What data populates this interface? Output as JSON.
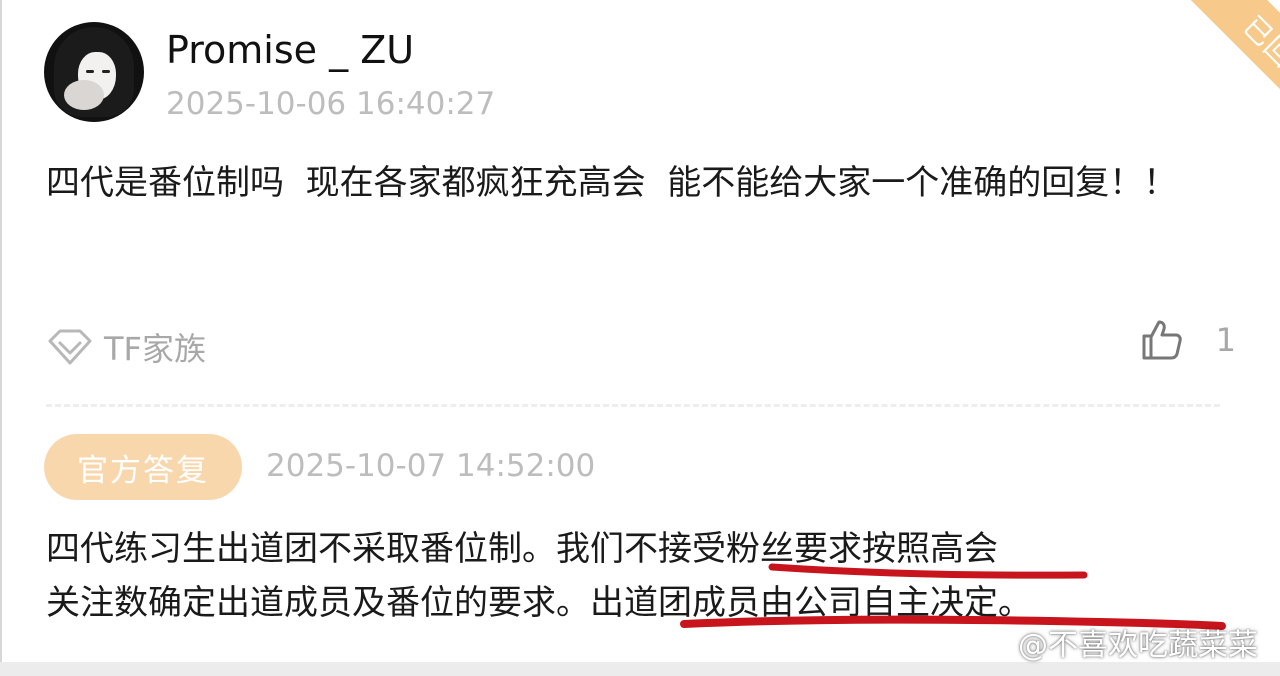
{
  "corner_badge": "已回复",
  "post": {
    "username": "Promise _ ZU",
    "timestamp": "2025-10-06 16:40:27",
    "content": "四代是番位制吗  现在各家都疯狂充高会  能不能给大家一个准确的回复！！",
    "tag": "TF家族",
    "like_count": "1"
  },
  "reply": {
    "badge": "官方答复",
    "timestamp": "2025-10-07 14:52:00",
    "line1": {
      "pre": "四代练习生出道团不采取番位制。我们",
      "highlight": "不接受粉丝要求",
      "post": "按照高会"
    },
    "line2": {
      "pre": "关注数确定出道成员及番位的要求。",
      "highlight": "出道团成员由公司自主决定。"
    }
  },
  "watermark": "@不喜欢吃蔬菜菜",
  "colors": {
    "badge_bg": "#f9d7ad",
    "corner_bg": "#f7c98a",
    "annotation_red": "#c8141c",
    "muted_text": "#bdbdbd"
  }
}
